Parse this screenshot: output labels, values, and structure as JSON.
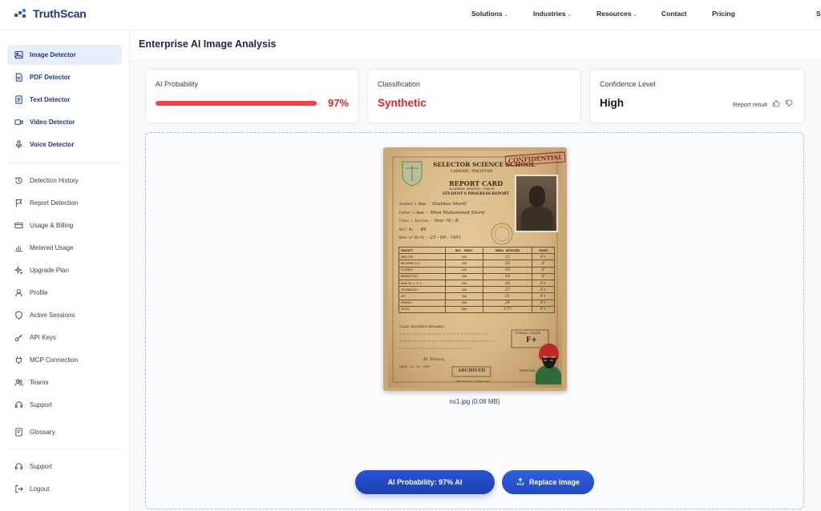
{
  "brand": {
    "name": "TruthScan",
    "accent": "#1d4ed8"
  },
  "topnav": [
    {
      "label": "Solutions",
      "dropdown": true
    },
    {
      "label": "Industries",
      "dropdown": true
    },
    {
      "label": "Resources",
      "dropdown": true
    },
    {
      "label": "Contact",
      "dropdown": false
    },
    {
      "label": "Pricing",
      "dropdown": false
    },
    {
      "label": "S",
      "dropdown": false
    }
  ],
  "sidebar": {
    "detectors": [
      {
        "label": "Image Detector",
        "icon": "image-icon",
        "active": true
      },
      {
        "label": "PDF Detector",
        "icon": "pdf-icon"
      },
      {
        "label": "Text Detector",
        "icon": "text-doc-icon"
      },
      {
        "label": "Video Detector",
        "icon": "video-icon"
      },
      {
        "label": "Voice Detector",
        "icon": "microphone-icon"
      }
    ],
    "account": [
      {
        "label": "Detection History",
        "icon": "history-icon"
      },
      {
        "label": "Report Detection",
        "icon": "flag-icon"
      },
      {
        "label": "Usage & Billing",
        "icon": "credit-card-icon"
      },
      {
        "label": "Metered Usage",
        "icon": "bar-chart-icon"
      },
      {
        "label": "Upgrade Plan",
        "icon": "sparkle-icon"
      },
      {
        "label": "Profile",
        "icon": "user-icon"
      },
      {
        "label": "Active Sessions",
        "icon": "shield-icon"
      },
      {
        "label": "API Keys",
        "icon": "key-icon"
      },
      {
        "label": "MCP Connection",
        "icon": "plug-icon"
      },
      {
        "label": "Teams",
        "icon": "team-icon"
      },
      {
        "label": "Support",
        "icon": "headset-icon"
      },
      {
        "label": "Glossary",
        "icon": "book-icon"
      }
    ],
    "footer": [
      {
        "label": "Support",
        "icon": "headset-icon"
      },
      {
        "label": "Logout",
        "icon": "logout-icon"
      }
    ]
  },
  "main": {
    "title": "Enterprise AI Image Analysis",
    "cards": {
      "probability": {
        "label": "AI Probability",
        "value": "97%",
        "fraction": 0.97
      },
      "classification": {
        "label": "Classification",
        "value": "Synthetic"
      },
      "confidence": {
        "label": "Confidence Level",
        "value": "High",
        "report_label": "Report result"
      }
    },
    "file": {
      "caption": "ns1.jpg (0.06 MB)"
    },
    "buttons": {
      "probability": "AI Probability: 97% AI",
      "replace": "Replace Image"
    }
  },
  "document": {
    "school": "SELECTOR SCIENCE SCHOOL",
    "city": "LAHORE, PAKISTAN",
    "session": "ACADEMIC SESSION : 1960-61",
    "title": "REPORT CARD",
    "subtitle": "STUDENT'S PROGRESS REPORT",
    "stamp": "CONFIDENTIAL",
    "fields": [
      {
        "k": "Student's Name",
        "v": "Shahbaz Sharif"
      },
      {
        "k": "Father's Name",
        "v": "Mian Muhammad Sharif"
      },
      {
        "k": "Class / Section",
        "v": "Year 10 - B"
      },
      {
        "k": "Roll No.",
        "v": "89"
      },
      {
        "k": "Date of Birth",
        "v": "23 - 09 - 1951"
      }
    ],
    "table_headers": [
      "SUBJECT",
      "MAX. MARKS",
      "MARKS OBTAINED",
      "GRADE"
    ],
    "rows": [
      [
        "ENGLISH",
        "100",
        "22",
        "F+"
      ],
      [
        "MATHEMATICS",
        "100",
        "20",
        "F"
      ],
      [
        "SCIENCE",
        "100",
        "19",
        "F"
      ],
      [
        "HUMANITIES",
        "100",
        "18",
        "F"
      ],
      [
        "HEALTH & P.E.",
        "100",
        "26",
        "F+"
      ],
      [
        "TECHNOLOGY",
        "100",
        "27",
        "F+"
      ],
      [
        "ART",
        "100",
        "21",
        "F+"
      ],
      [
        "FRENCH",
        "100",
        "24",
        "F+"
      ],
      [
        "TOTAL",
        "800",
        "177",
        "F+"
      ]
    ],
    "remarks_label": "CLASS TEACHER'S REMARKS :",
    "overall_label": "OVERALL GRADE",
    "overall_grade": "F+",
    "teacher": "M. Farooq",
    "date": "DATE : 22 - 05 - 1961",
    "archived": "ARCHIVED",
    "archived_sub": "THE SCHOOL, LAHORE 1961",
    "principal": "PRINCIPAL"
  }
}
